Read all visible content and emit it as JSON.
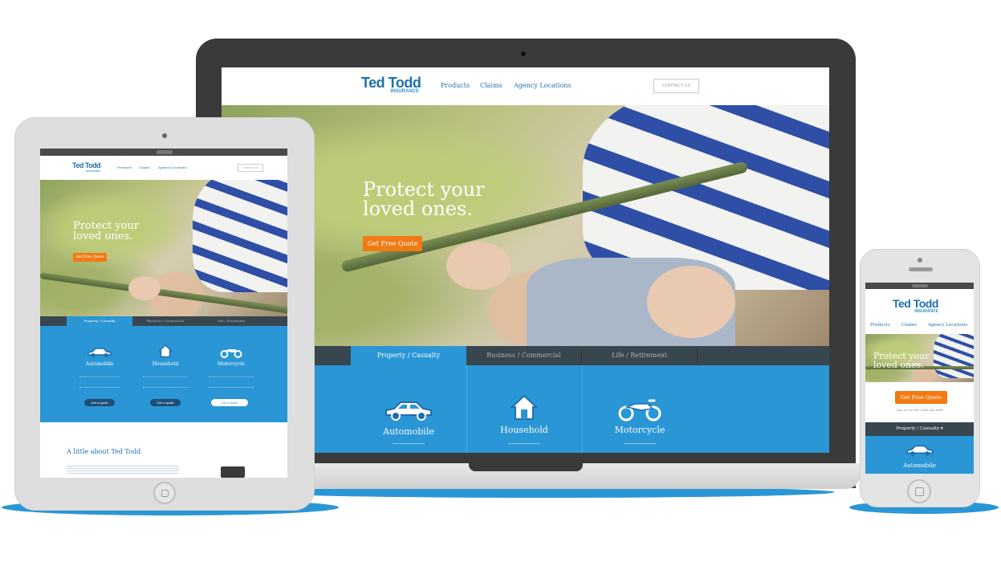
{
  "brand": {
    "name": "Ted Todd",
    "tagline": "INSURANCE",
    "colors": {
      "primary": "#2a96d6",
      "navy": "#1e6fae",
      "accent": "#f07a14",
      "tabbar": "#38464f"
    }
  },
  "nav": {
    "links": [
      "Products",
      "Claims",
      "Agency Locations"
    ],
    "contact": "CONTACT US"
  },
  "hero": {
    "line1": "Protect your",
    "line2": "loved ones.",
    "cta": "Get Free Quote"
  },
  "tabs": [
    "Property / Casualty",
    "Business / Commercial",
    "Life / Retirement"
  ],
  "categories": [
    {
      "label": "Automobile",
      "icon": "car-icon",
      "quote": "Get a quote"
    },
    {
      "label": "Household",
      "icon": "house-icon",
      "quote": "Get a quote"
    },
    {
      "label": "Motorcycle",
      "icon": "motorcycle-icon",
      "quote": "Get a quote"
    }
  ],
  "about": {
    "heading": "A little about Ted Todd"
  },
  "phone": {
    "call_line": "Call us Toll Free 1-800-313-6006",
    "dropdown": "Property / Casualty",
    "dropdown_icon": "caret-down-icon"
  }
}
